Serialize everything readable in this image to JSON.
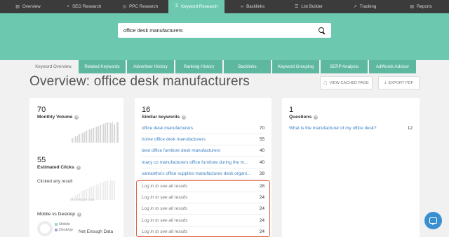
{
  "topnav": {
    "items": [
      {
        "label": "Overview",
        "icon": "bar-chart-icon"
      },
      {
        "label": "SEO Research",
        "icon": "search-icon"
      },
      {
        "label": "PPC Research",
        "icon": "target-icon"
      },
      {
        "label": "Keyword Research",
        "icon": "key-icon"
      },
      {
        "label": "Backlinks",
        "icon": "link-icon"
      },
      {
        "label": "List Builder",
        "icon": "list-icon"
      },
      {
        "label": "Tracking",
        "icon": "trend-icon"
      },
      {
        "label": "Reports",
        "icon": "document-icon"
      }
    ],
    "active": "Keyword Research"
  },
  "search": {
    "query": "office desk manufacturers"
  },
  "tabs": [
    {
      "label": "Keyword Overview"
    },
    {
      "label": "Related Keywords"
    },
    {
      "label": "Advertiser History"
    },
    {
      "label": "Ranking History"
    },
    {
      "label": "Backlinks"
    },
    {
      "label": "Keyword Grouping"
    },
    {
      "label": "SERP Analysis"
    },
    {
      "label": "AdWords Advisor"
    }
  ],
  "header": {
    "title": "Overview: office desk manufacturers",
    "view_cached": "VIEW CACHED PAGE",
    "export_pdf": "EXPORT PDF"
  },
  "volume_card": {
    "volume": "70",
    "volume_label": "Monthly Volume",
    "clicks": "55",
    "clicks_label": "Estimated Clicks",
    "clicked_any": "Clicked any result",
    "not_enough_small": "Not Enough Data",
    "mobile_label": "Mobile vs Desktop",
    "legend_mobile": "Mobile",
    "legend_desktop": "Desktop",
    "not_enough": "Not Enough Data",
    "colors": {
      "mobile": "#9fd9c9",
      "desktop": "#a9a0d6"
    }
  },
  "similar_card": {
    "count": "16",
    "label": "Similar keywords",
    "rows": [
      {
        "text": "office desk manufacturers",
        "value": "70"
      },
      {
        "text": "home office desk manufacturers",
        "value": "55"
      },
      {
        "text": "best office furniture desk manufacturers",
        "value": "40"
      },
      {
        "text": "macy co manufacturers office furniture during the m...",
        "value": "40"
      },
      {
        "text": "samantha's office supplies manufactures desk organi...",
        "value": "28"
      }
    ],
    "locked_rows": [
      {
        "text": "Log in to see all results",
        "value": "28"
      },
      {
        "text": "Log in to see all results",
        "value": "24"
      },
      {
        "text": "Log in to see all results",
        "value": "24"
      },
      {
        "text": "Log in to see all results",
        "value": "24"
      },
      {
        "text": "Log in to see all results",
        "value": "24"
      }
    ]
  },
  "questions_card": {
    "count": "1",
    "label": "Questions",
    "rows": [
      {
        "text": "What is the manufacturer of my office desk?",
        "value": "12"
      }
    ]
  }
}
